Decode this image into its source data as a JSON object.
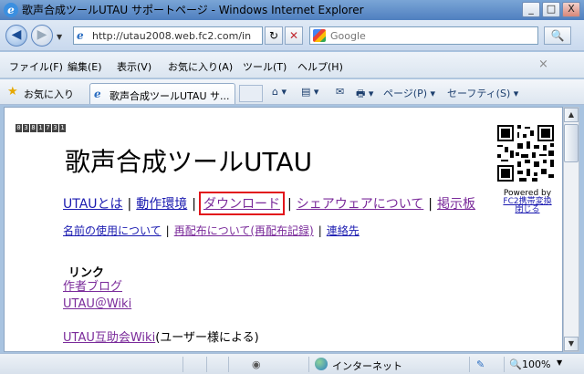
{
  "window": {
    "title": "歌声合成ツールUTAU サポートページ - Windows Internet Explorer",
    "minimize": "_",
    "maximize": "□",
    "close": "X"
  },
  "address": {
    "url": "http://utau2008.web.fc2.com/in",
    "search_placeholder": "Google",
    "refresh": "↻",
    "stop": "✕",
    "search_go": "🔍"
  },
  "menu": {
    "items": [
      "ファイル(F)",
      "編集(E)",
      "表示(V)",
      "お気に入り(A)",
      "ツール(T)",
      "ヘルプ(H)"
    ],
    "close": "×"
  },
  "favorites": {
    "label": "お気に入り",
    "tab_label": "歌声合成ツールUTAU サ...",
    "commands": [
      "⌂ ▾",
      "▤ ▾",
      "✉",
      "🖶 ▾",
      "ページ(P) ▾",
      "セーフティ(S) ▾"
    ]
  },
  "page": {
    "counter": [
      "0",
      "3",
      "8",
      "1",
      "7",
      "3",
      "1"
    ],
    "title": "歌声合成ツールUTAU",
    "nav": [
      "UTAUとは",
      "動作環境",
      "ダウンロード",
      "シェアウェアについて",
      "掲示板"
    ],
    "subnav": [
      "名前の使用について",
      "再配布について(再配布記録)",
      "連絡先"
    ],
    "links_heading": "リンク",
    "links": [
      {
        "text": "作者ブログ",
        "suffix": ""
      },
      {
        "text": "UTAU＠Wiki",
        "suffix": ""
      },
      {
        "text": "UTAU互助会Wiki",
        "suffix": "(ユーザー様による)"
      }
    ],
    "qr_powered": "Powered by",
    "qr_link": "FC2携帯変換",
    "qr_close": "閉じる"
  },
  "status": {
    "zone": "インターネット",
    "zoom": "100%"
  },
  "colors": {
    "highlight_box": "#e2141b",
    "link": "#1a1ab0",
    "visited_link": "#7a2a9a"
  }
}
